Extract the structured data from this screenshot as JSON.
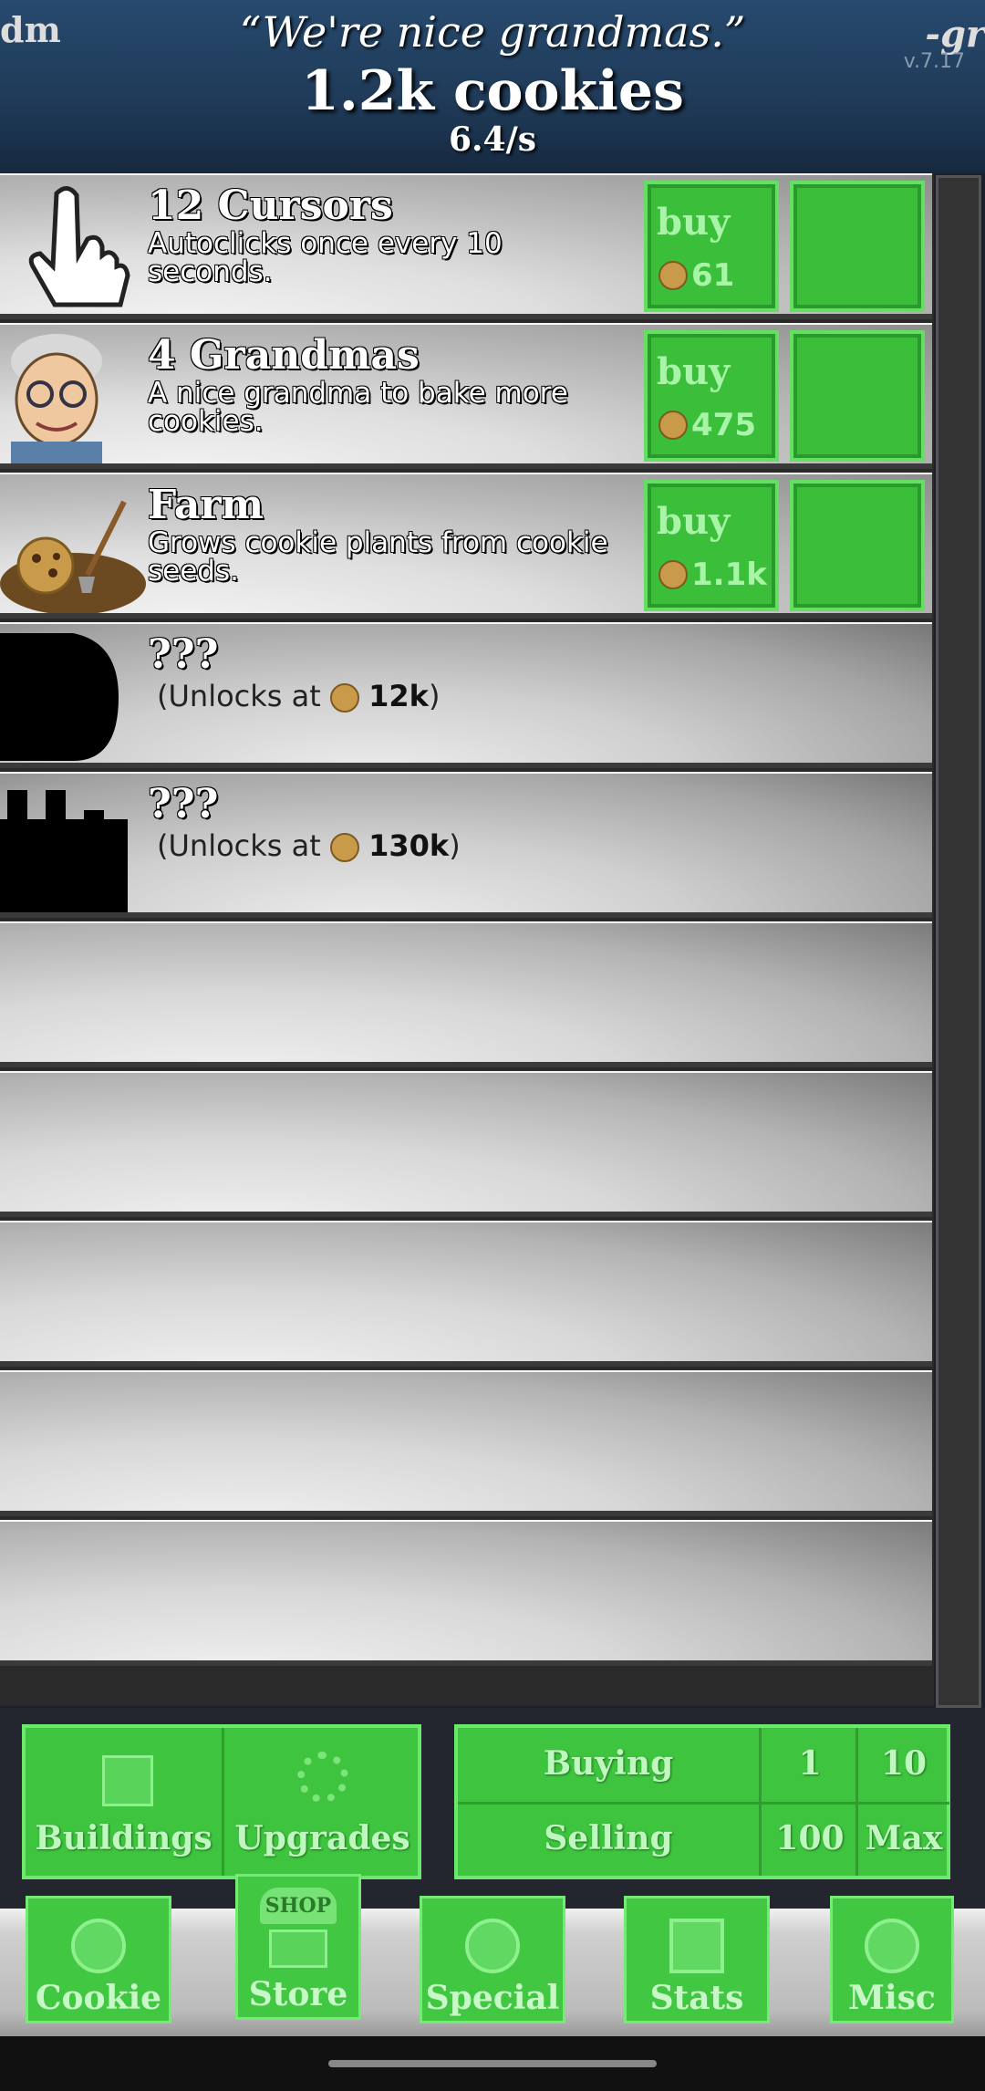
{
  "header": {
    "quote_left": "dm",
    "quote": "“We're nice grandmas.”",
    "quote_right": "-gr",
    "version": "v.7.17",
    "cookie_count": "1.2k cookies",
    "cps": "6.4/s"
  },
  "store": {
    "buildings": [
      {
        "name": "12 Cursors",
        "desc": "Autoclicks once every 10 seconds.",
        "buy_label": "buy",
        "price": "61",
        "icon": "cursor-hand-icon"
      },
      {
        "name": "4 Grandmas",
        "desc": "A nice grandma to bake more cookies.",
        "buy_label": "buy",
        "price": "475",
        "icon": "grandma-icon"
      },
      {
        "name": "Farm",
        "desc": "Grows cookie plants from cookie seeds.",
        "buy_label": "buy",
        "price": "1.1k",
        "icon": "farm-icon"
      }
    ],
    "locked": [
      {
        "name": "???",
        "unlock_prefix": "(Unlocks at",
        "unlock_value": "12k",
        "unlock_suffix": ")"
      },
      {
        "name": "???",
        "unlock_prefix": "(Unlocks at",
        "unlock_value": "130k",
        "unlock_suffix": ")"
      }
    ]
  },
  "controls": {
    "buildings": "Buildings",
    "upgrades": "Upgrades",
    "buying": "Buying",
    "selling": "Selling",
    "qty_1": "1",
    "qty_10": "10",
    "qty_100": "100",
    "qty_max": "Max"
  },
  "nav": {
    "tabs": [
      {
        "label": "Cookie",
        "icon": "cookie-icon"
      },
      {
        "label": "Store",
        "icon": "shop-icon"
      },
      {
        "label": "Special",
        "icon": "special-icon"
      },
      {
        "label": "Stats",
        "icon": "stats-icon"
      },
      {
        "label": "Misc",
        "icon": "misc-icon"
      }
    ],
    "shop_sign": "SHOP"
  }
}
